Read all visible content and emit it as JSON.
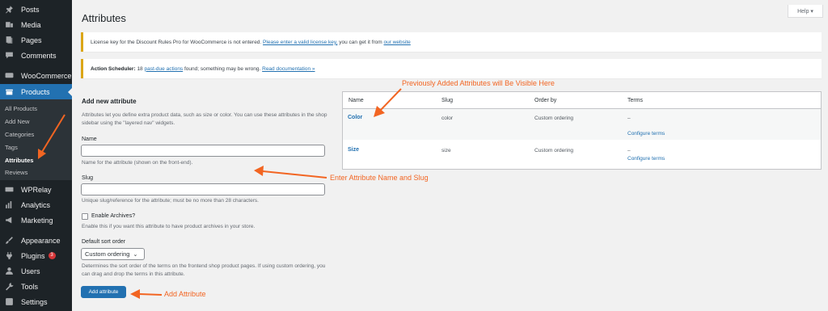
{
  "sidebar": {
    "items": [
      {
        "label": "Posts",
        "icon": "pin-icon"
      },
      {
        "label": "Media",
        "icon": "media-icon"
      },
      {
        "label": "Pages",
        "icon": "pages-icon"
      },
      {
        "label": "Comments",
        "icon": "comments-icon"
      },
      {
        "label": "WooCommerce",
        "icon": "woocommerce-icon"
      },
      {
        "label": "Products",
        "icon": "products-icon"
      },
      {
        "label": "WPRelay",
        "icon": "wprelay-icon"
      },
      {
        "label": "Analytics",
        "icon": "analytics-icon"
      },
      {
        "label": "Marketing",
        "icon": "megaphone-icon"
      },
      {
        "label": "Appearance",
        "icon": "brush-icon"
      },
      {
        "label": "Plugins",
        "icon": "plug-icon",
        "badge": "3"
      },
      {
        "label": "Users",
        "icon": "users-icon"
      },
      {
        "label": "Tools",
        "icon": "wrench-icon"
      },
      {
        "label": "Settings",
        "icon": "settings-icon"
      }
    ],
    "submenu": [
      "All Products",
      "Add New",
      "Categories",
      "Tags",
      "Attributes",
      "Reviews"
    ]
  },
  "header": {
    "title": "Attributes",
    "help_label": "Help ▾"
  },
  "notices": {
    "license_text": "License key for the Discount Rules Pro for WooCommerce is not entered.",
    "license_link": "Please enter a valid license key,",
    "license_mid": "you can get it from",
    "license_site": "our website",
    "scheduler_label": "Action Scheduler:",
    "scheduler_count": "18",
    "scheduler_link": "past-due actions",
    "scheduler_text": "found; something may be wrong.",
    "scheduler_doc": "Read documentation »"
  },
  "form": {
    "title": "Add new attribute",
    "intro": "Attributes let you define extra product data, such as size or color. You can use these attributes in the shop sidebar using the \"layered nav\" widgets.",
    "name_label": "Name",
    "name_value": "",
    "name_help": "Name for the attribute (shown on the front-end).",
    "slug_label": "Slug",
    "slug_value": "",
    "slug_help": "Unique slug/reference for the attribute; must be no more than 28 characters.",
    "archives_label": "Enable Archives?",
    "archives_help": "Enable this if you want this attribute to have product archives in your store.",
    "sort_label": "Default sort order",
    "sort_value": "Custom ordering",
    "sort_help": "Determines the sort order of the terms on the frontend shop product pages. If using custom ordering, you can drag and drop the terms in this attribute.",
    "submit_label": "Add attribute"
  },
  "table": {
    "headers": [
      "Name",
      "Slug",
      "Order by",
      "Terms"
    ],
    "rows": [
      {
        "name": "Color",
        "slug": "color",
        "order": "Custom ordering",
        "terms": "–",
        "configure": "Configure terms"
      },
      {
        "name": "Size",
        "slug": "size",
        "order": "Custom ordering",
        "terms": "–",
        "configure": "Configure terms"
      }
    ]
  },
  "annotations": {
    "visible_here": "Previously Added Attributes will Be Visible Here",
    "name_slug": "Enter Attribute Name and Slug",
    "add": "Add Attribute"
  },
  "colors": {
    "sidebar_bg": "#1d2327",
    "accent": "#2271b1",
    "warning": "#dba617",
    "annotation": "#f26522",
    "badge": "#d63638"
  }
}
